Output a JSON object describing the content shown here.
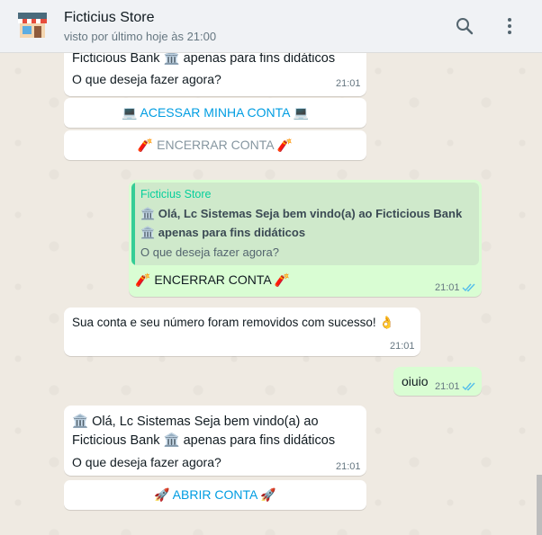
{
  "header": {
    "contact_name": "Ficticius Store",
    "status": "visto por último hoje às 21:00",
    "icons": [
      "store-avatar-icon",
      "search-icon",
      "more-vert-icon"
    ]
  },
  "messages": {
    "m1": {
      "line1": "Ficticious Bank 🏛️ apenas para fins didáticos",
      "line2": "O que deseja fazer agora?",
      "time": "21:01"
    },
    "btn_acessar": "💻 ACESSAR MINHA CONTA 💻",
    "btn_encerrar": "🧨 ENCERRAR CONTA 🧨",
    "reply": {
      "quoted_author": "Ficticius Store",
      "quoted_line1": "🏛️ Olá, Lc Sistemas Seja bem vindo(a) ao Ficticious Bank",
      "quoted_line2": "🏛️ apenas para fins didáticos",
      "quoted_line3": "O que deseja fazer agora?",
      "text": "🧨 ENCERRAR CONTA 🧨",
      "time": "21:01"
    },
    "m3": {
      "text": "Sua conta e seu número foram removidos com sucesso! 👌",
      "time": "21:01"
    },
    "m4": {
      "text": "oiuio",
      "time": "21:01"
    },
    "m5": {
      "line1": "🏛️ Olá, Lc Sistemas Seja bem vindo(a) ao",
      "line2": "Ficticious Bank 🏛️ apenas para fins didáticos",
      "line3": "O que deseja fazer agora?",
      "time": "21:01"
    },
    "btn_abrir": "🚀 ABRIR CONTA 🚀"
  },
  "colors": {
    "incoming": "#ffffff",
    "outgoing": "#d9fdd3",
    "link_blue": "#009de2",
    "read_ticks": "#53bdeb"
  }
}
